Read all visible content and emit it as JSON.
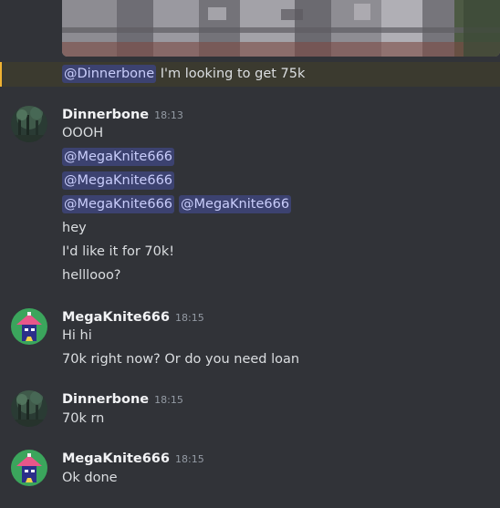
{
  "reply": {
    "mention": "@Dinnerbone",
    "text": "I'm looking to get 75k"
  },
  "messages": [
    {
      "author": "Dinnerbone",
      "time": "18:13",
      "avatar": "forest-avatar",
      "lines": [
        {
          "text": "OOOH"
        },
        {
          "mentions": [
            "@MegaKnite666"
          ]
        },
        {
          "mentions": [
            "@MegaKnite666"
          ]
        },
        {
          "mentions": [
            "@MegaKnite666",
            "@MegaKnite666"
          ]
        },
        {
          "text": "hey"
        },
        {
          "text": "I'd like it for 70k!"
        },
        {
          "text": "helllooo?"
        }
      ]
    },
    {
      "author": "MegaKnite666",
      "time": "18:15",
      "avatar": "knight-avatar",
      "lines": [
        {
          "text": "Hi hi"
        },
        {
          "text": "70k right now? Or do you need loan"
        }
      ]
    },
    {
      "author": "Dinnerbone",
      "time": "18:15",
      "avatar": "forest-avatar",
      "lines": [
        {
          "text": "70k rn"
        }
      ]
    },
    {
      "author": "MegaKnite666",
      "time": "18:15",
      "avatar": "knight-avatar",
      "lines": [
        {
          "text": "Ok done"
        }
      ]
    }
  ],
  "colors": {
    "background": "#313338",
    "mention_bg": "#3c4270",
    "mention_fg": "#c9cdfb",
    "highlight_bg": "#3b3a2f",
    "highlight_bar": "#f0b232"
  }
}
